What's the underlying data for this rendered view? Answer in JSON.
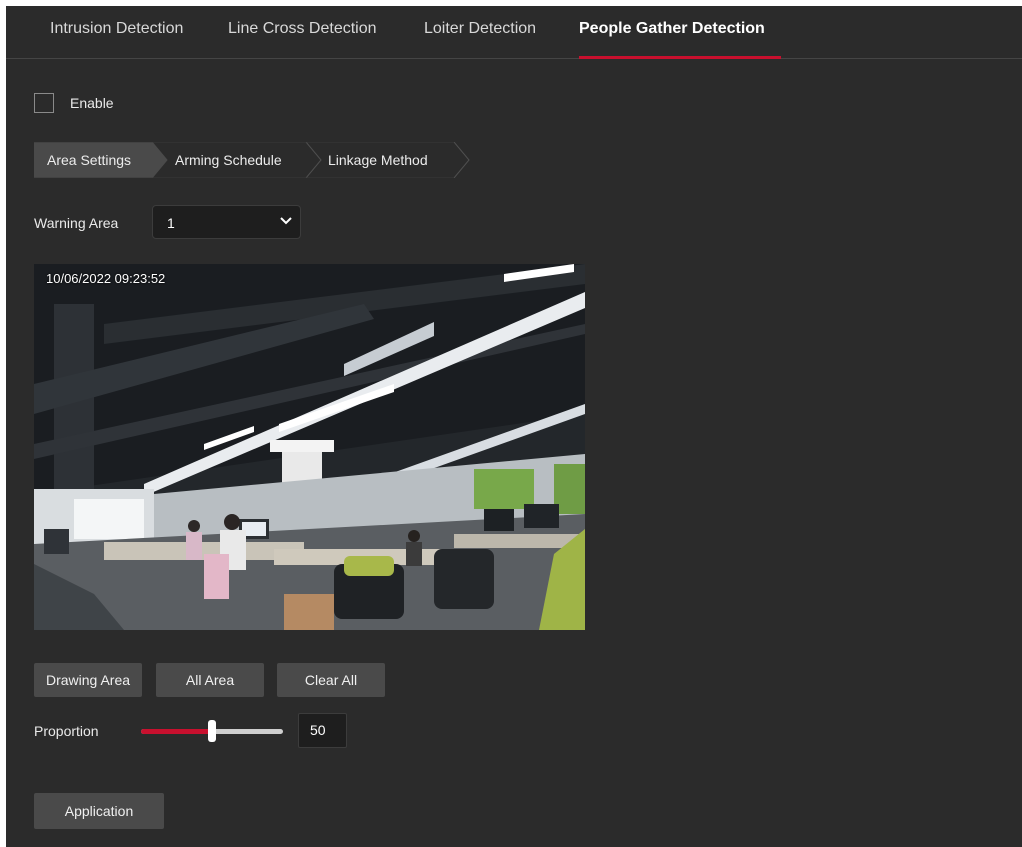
{
  "tabs": [
    {
      "label": "Intrusion Detection",
      "active": false
    },
    {
      "label": "Line Cross Detection",
      "active": false
    },
    {
      "label": "Loiter Detection",
      "active": false
    },
    {
      "label": "People Gather Detection",
      "active": true
    }
  ],
  "enable": {
    "label": "Enable",
    "checked": false
  },
  "steps": [
    {
      "label": "Area Settings",
      "active": true
    },
    {
      "label": "Arming Schedule",
      "active": false
    },
    {
      "label": "Linkage Method",
      "active": false
    }
  ],
  "warning_area": {
    "label": "Warning Area",
    "selected": "1"
  },
  "video": {
    "timestamp": "10/06/2022  09:23:52"
  },
  "area_buttons": {
    "drawing": "Drawing Area",
    "all": "All Area",
    "clear": "Clear All"
  },
  "proportion": {
    "label": "Proportion",
    "value": "50",
    "fraction": 0.5
  },
  "apply_label": "Application",
  "colors": {
    "accent": "#c8102e",
    "panel": "#2b2b2b",
    "button": "#4a4a4a"
  },
  "icons": {
    "select": "chevron-down-icon"
  }
}
